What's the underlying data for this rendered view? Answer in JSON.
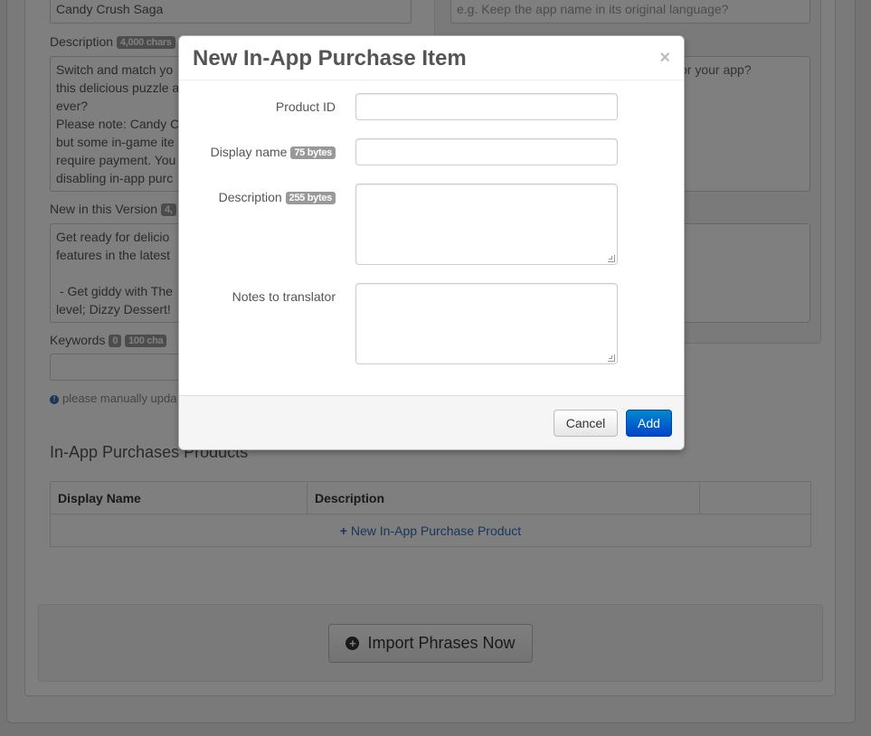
{
  "background": {
    "app_name_value": "Candy Crush Saga",
    "notes_placeholder": "e.g. Keep the app name in its original language?",
    "description_label": "Description",
    "description_badge": "4,000 chars",
    "description_text": "Switch and match yo\nthis delicious puzzle a\never?\nPlease note: Candy C\nbut some in-game ite\nrequire payment. You\ndisabling in-app purc",
    "right_description_fragment": "or your app?",
    "new_version_label": "New in this Version",
    "new_version_badge": "4,",
    "new_version_text": "Get ready for delicio\nfeatures in the latest\n\n - Get giddy with The\nlevel; Dizzy Dessert!",
    "keywords_label": "Keywords",
    "keywords_count": "0",
    "keywords_badge": "100 cha",
    "note_text": "please manually upda",
    "section_title": "In-App Purchases Products",
    "table": {
      "headers": [
        "Display Name",
        "Description",
        ""
      ],
      "add_row_label": "New In-App Purchase Product",
      "add_row_icon": "+"
    },
    "import_button_label": "Import Phrases Now",
    "import_button_icon": "+"
  },
  "modal": {
    "title": "New In-App Purchase Item",
    "close_glyph": "×",
    "fields": {
      "product_id": {
        "label": "Product ID",
        "value": ""
      },
      "display_name": {
        "label": "Display name",
        "badge": "75 bytes",
        "value": ""
      },
      "description": {
        "label": "Description",
        "badge": "255 bytes",
        "value": ""
      },
      "notes": {
        "label": "Notes to translator",
        "value": ""
      }
    },
    "cancel_label": "Cancel",
    "add_label": "Add"
  },
  "colors": {
    "primary": "#0055cc",
    "link": "#2f6fb5",
    "badge": "#999999"
  }
}
